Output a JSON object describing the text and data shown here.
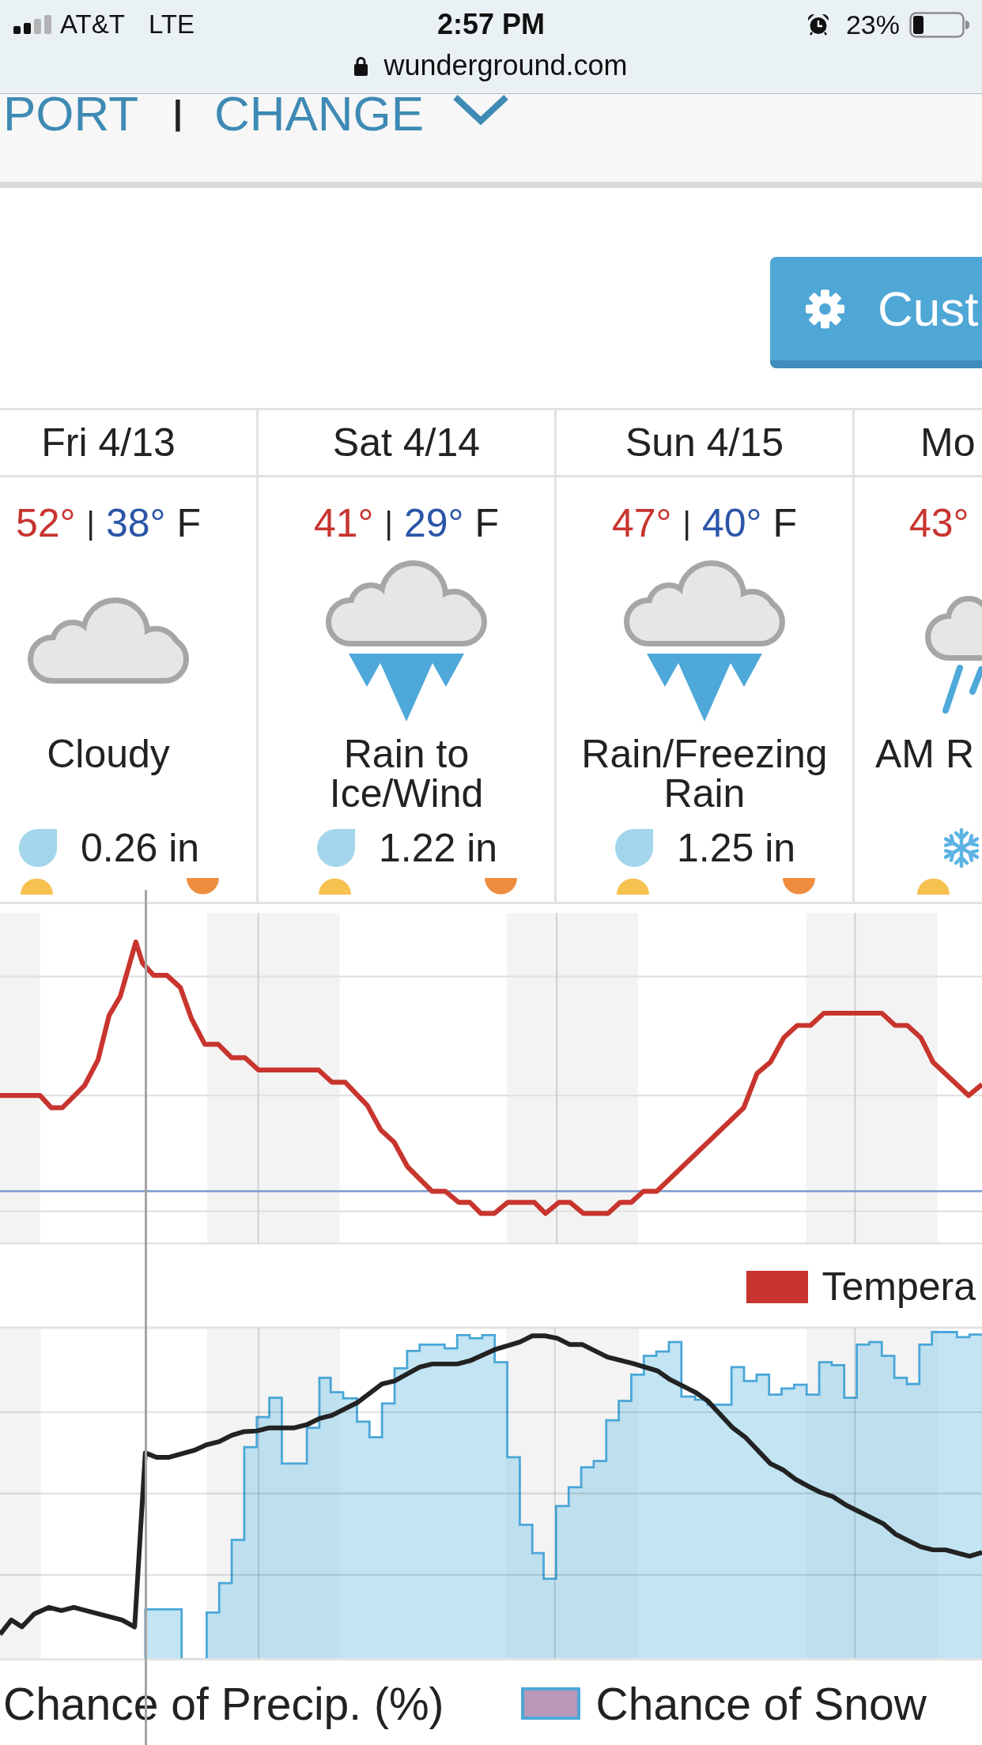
{
  "status_bar": {
    "carrier": "AT&T",
    "network": "LTE",
    "time": "2:57 PM",
    "battery": "23%",
    "url": "wunderground.com"
  },
  "nav": {
    "items": [
      "PORT",
      "CHANGE"
    ],
    "separator": "|"
  },
  "customize_button": {
    "label": "Cust"
  },
  "days": [
    {
      "name": "Fri 4/13",
      "high": "52°",
      "sep": "|",
      "low": "38°",
      "unit": "F",
      "kind": "cloudy",
      "condition": "Cloudy",
      "precip": "0.26 in"
    },
    {
      "name": "Sat 4/14",
      "high": "41°",
      "sep": "|",
      "low": "29°",
      "unit": "F",
      "kind": "ice",
      "condition": "Rain to Ice/Wind",
      "precip": "1.22 in"
    },
    {
      "name": "Sun 4/15",
      "high": "47°",
      "sep": "|",
      "low": "40°",
      "unit": "F",
      "kind": "ice",
      "condition": "Rain/Freezing Rain",
      "precip": "1.25 in"
    }
  ],
  "partial_day": {
    "name": "Mo",
    "high": "43°",
    "condition": "AM R"
  },
  "temperature_chart": {
    "legend": "Tempera"
  },
  "precip_chart": {
    "legends": [
      "Chance of Precip. (%)",
      "Chance of Snow"
    ]
  }
}
